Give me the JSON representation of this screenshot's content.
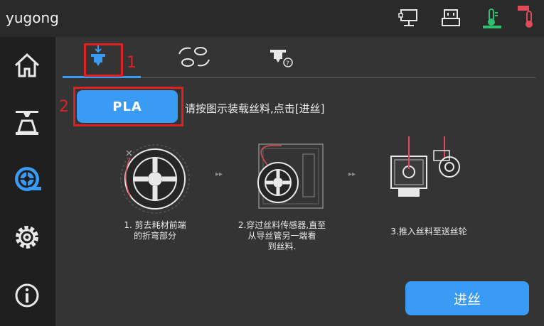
{
  "app": {
    "title": "yugong"
  },
  "markers": {
    "first": "1",
    "second": "2"
  },
  "material": {
    "button_label": "PLA"
  },
  "instruction": "请按图示装载丝料,点击[进丝]",
  "steps": [
    {
      "line1": "1. 剪去耗材前端",
      "line2": "的折弯部分",
      "line3": ""
    },
    {
      "line1": "2.穿过丝料传感器,直至",
      "line2": "从导丝管另一端看",
      "line3": "到丝料."
    },
    {
      "line1": "3.推入丝料至送丝轮",
      "line2": "",
      "line3": ""
    }
  ],
  "arrows": [
    "▸▸",
    "▸▸"
  ],
  "actions": {
    "feed_label": "进丝"
  },
  "colors": {
    "accent": "#3a9bf5",
    "highlight": "#e02020",
    "temp_green": "#2fbf71",
    "temp_red": "#e04a5a"
  }
}
